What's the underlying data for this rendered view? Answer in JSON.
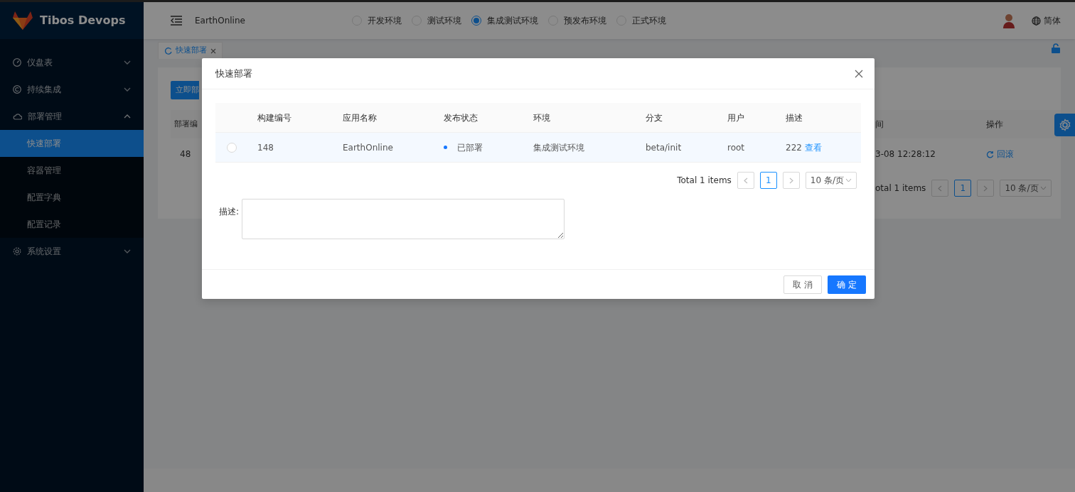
{
  "sidebar": {
    "brand": "Tibos Devops",
    "items": [
      {
        "label": "仪盘表",
        "expanded": false
      },
      {
        "label": "持续集成",
        "expanded": false
      },
      {
        "label": "部署管理",
        "expanded": true,
        "children": [
          {
            "label": "快速部署",
            "selected": true
          },
          {
            "label": "容器管理",
            "selected": false
          },
          {
            "label": "配置字典",
            "selected": false
          },
          {
            "label": "配置记录",
            "selected": false
          }
        ]
      },
      {
        "label": "系统设置",
        "expanded": false
      }
    ]
  },
  "header": {
    "project": "EarthOnline",
    "environments": [
      {
        "label": "开发环境",
        "selected": false
      },
      {
        "label": "测试环境",
        "selected": false
      },
      {
        "label": "集成测试环境",
        "selected": true
      },
      {
        "label": "预发布环境",
        "selected": false
      },
      {
        "label": "正式环境",
        "selected": false
      }
    ],
    "language": "简体"
  },
  "tabs": [
    {
      "label": "快速部署",
      "selected": true
    }
  ],
  "page": {
    "action_button": "立即部",
    "left_column": {
      "header": "部署编",
      "cell": "48"
    },
    "right_columns": [
      "间",
      "操作"
    ],
    "right_row": [
      "3-08 12:28:12",
      "回滚"
    ],
    "pagination": {
      "total": "otal 1 items",
      "pages": [
        {
          "label": "1",
          "selected": true
        }
      ],
      "page_size": "10 条/页"
    }
  },
  "modal": {
    "title": "快速部署",
    "table": {
      "columns": [
        "构建编号",
        "应用名称",
        "发布状态",
        "环境",
        "分支",
        "用户",
        "描述"
      ],
      "rows": [
        {
          "selected": false,
          "build": "148",
          "app": "EarthOnline",
          "status": {
            "label": "已部署",
            "color": "#1677ff"
          },
          "environment": "集成测试环境",
          "branch": "beta/init",
          "user": "root",
          "description": "222",
          "link": "查看"
        }
      ]
    },
    "pagination": {
      "total": "Total 1 items",
      "pages": [
        {
          "label": "1",
          "selected": true
        }
      ],
      "page_size": "10 条/页"
    },
    "form": {
      "label": "描述:"
    },
    "buttons": {
      "cancel": "取 消",
      "ok": "确 定"
    }
  }
}
